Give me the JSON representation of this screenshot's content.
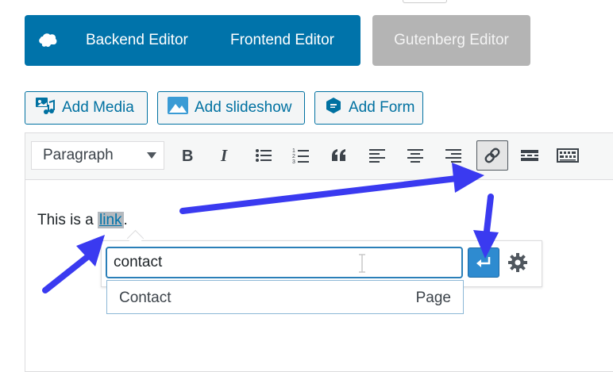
{
  "modes": {
    "logo_icon": "wpbakery-cloud-icon",
    "backend": "Backend Editor",
    "frontend": "Frontend Editor",
    "gutenberg": "Gutenberg Editor"
  },
  "media_buttons": {
    "add_media": "Add Media",
    "add_slideshow": "Add slideshow",
    "add_form": "Add Form"
  },
  "toolbar": {
    "format_value": "Paragraph",
    "buttons": [
      "bold",
      "italic",
      "bulleted-list",
      "numbered-list",
      "blockquote",
      "align-left",
      "align-center",
      "align-right",
      "insert-link",
      "read-more",
      "toolbar-toggle"
    ],
    "active": "insert-link"
  },
  "content": {
    "before": "This is a ",
    "link": "link",
    "after": "."
  },
  "link_dialog": {
    "input_value": "contact",
    "suggestion_title": "Contact",
    "suggestion_type": "Page"
  },
  "colors": {
    "primary_blue": "#0073aa",
    "annotation_arrow": "#3a3af0",
    "disabled_gray": "#b4b4b4"
  }
}
